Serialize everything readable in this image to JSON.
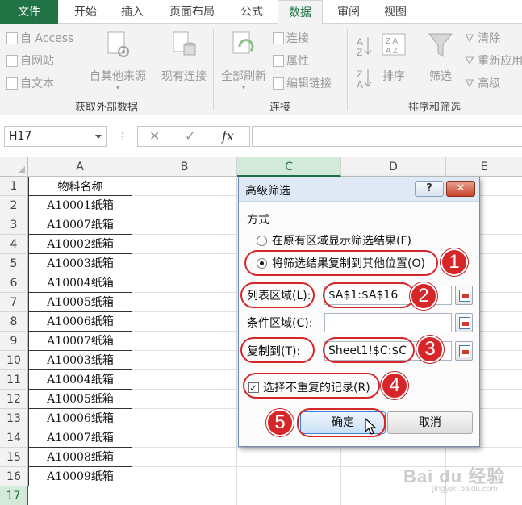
{
  "tabs": [
    {
      "label": "文件",
      "state": "file"
    },
    {
      "label": "开始",
      "state": ""
    },
    {
      "label": "插入",
      "state": ""
    },
    {
      "label": "页面布局",
      "state": ""
    },
    {
      "label": "公式",
      "state": ""
    },
    {
      "label": "数据",
      "state": "active"
    },
    {
      "label": "审阅",
      "state": ""
    },
    {
      "label": "视图",
      "state": ""
    }
  ],
  "ribbon": {
    "get_external": {
      "from_access": "自 Access",
      "from_web": "自网站",
      "from_text": "自文本",
      "from_other": "自其他来源",
      "existing": "现有连接",
      "label": "获取外部数据"
    },
    "connections": {
      "refresh_all": "全部刷新",
      "connections": "连接",
      "properties": "属性",
      "edit_links": "编辑链接",
      "label": "连接"
    },
    "sort_filter": {
      "sort": "排序",
      "filter": "筛选",
      "clear": "清除",
      "reapply": "重新应用",
      "advanced": "高级",
      "label": "排序和筛选"
    }
  },
  "formula_bar": {
    "name_box": "H17",
    "dots": "⋮",
    "cancel": "✕",
    "enter": "✓",
    "fx": "fx",
    "value": ""
  },
  "sheet": {
    "columns": [
      "A",
      "B",
      "C",
      "D",
      "E"
    ],
    "selected_column": "C",
    "rows": [
      "1",
      "2",
      "3",
      "4",
      "5",
      "6",
      "7",
      "8",
      "9",
      "10",
      "11",
      "12",
      "13",
      "14",
      "15",
      "16",
      "17"
    ],
    "selected_row": "17",
    "column_a": [
      "物料名称",
      "A10001纸箱",
      "A10007纸箱",
      "A10002纸箱",
      "A10003纸箱",
      "A10004纸箱",
      "A10005纸箱",
      "A10006纸箱",
      "A10007纸箱",
      "A10003纸箱",
      "A10004纸箱",
      "A10005纸箱",
      "A10006纸箱",
      "A10007纸箱",
      "A10008纸箱",
      "A10009纸箱"
    ]
  },
  "dialog": {
    "title": "高级筛选",
    "help": "?",
    "close": "✕",
    "mode_label": "方式",
    "radio_inplace": "在原有区域显示筛选结果(F)",
    "radio_copy": "将筛选结果复制到其他位置(O)",
    "list_range_label": "列表区域(L):",
    "list_range_value": "$A$1:$A$16",
    "criteria_label": "条件区域(C):",
    "criteria_value": "",
    "copy_to_label": "复制到(T):",
    "copy_to_value": "Sheet1!$C:$C",
    "unique_label": "选择不重复的记录(R)",
    "unique_checked": true,
    "ok": "确定",
    "cancel": "取消"
  },
  "annotations": [
    "1",
    "2",
    "3",
    "4",
    "5"
  ],
  "watermark": {
    "text": "Bai du 经验",
    "sub": "jingyan.baidu.com"
  },
  "colors": {
    "excel_green": "#217346",
    "annotation_red": "#d7262a",
    "dialog_border": "#6b8fb8"
  }
}
